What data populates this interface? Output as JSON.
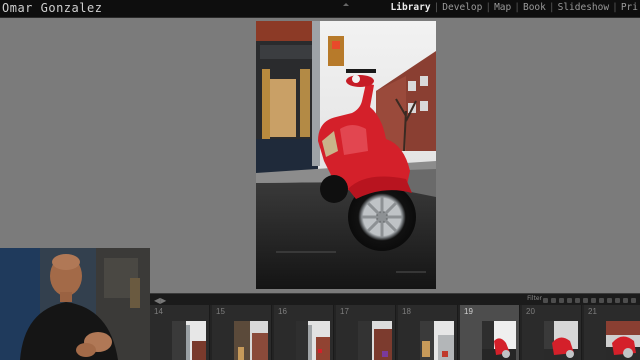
{
  "identity_plate": "Omar Gonzalez",
  "modules": [
    {
      "label": "Library",
      "active": true
    },
    {
      "label": "Develop",
      "active": false
    },
    {
      "label": "Map",
      "active": false
    },
    {
      "label": "Book",
      "active": false
    },
    {
      "label": "Slideshow",
      "active": false
    },
    {
      "label": "Pri",
      "active": false
    }
  ],
  "separator": "|",
  "main_photo": {
    "subject": "red-scooter-street-scene"
  },
  "filmstrip": {
    "filter_label": "Filter",
    "frames": [
      {
        "number": "14",
        "selected": false
      },
      {
        "number": "15",
        "selected": false
      },
      {
        "number": "16",
        "selected": false
      },
      {
        "number": "17",
        "selected": false
      },
      {
        "number": "18",
        "selected": false
      },
      {
        "number": "19",
        "selected": true
      },
      {
        "number": "20",
        "selected": false
      },
      {
        "number": "21",
        "selected": false
      }
    ]
  },
  "colors": {
    "background": "#7b7b7b",
    "topbar": "#0e0e0e",
    "scooter_red": "#d4202a",
    "filmstrip": "#232323"
  },
  "icons": [
    "panel-toggle-icon",
    "filmstrip-arrow-icon"
  ]
}
